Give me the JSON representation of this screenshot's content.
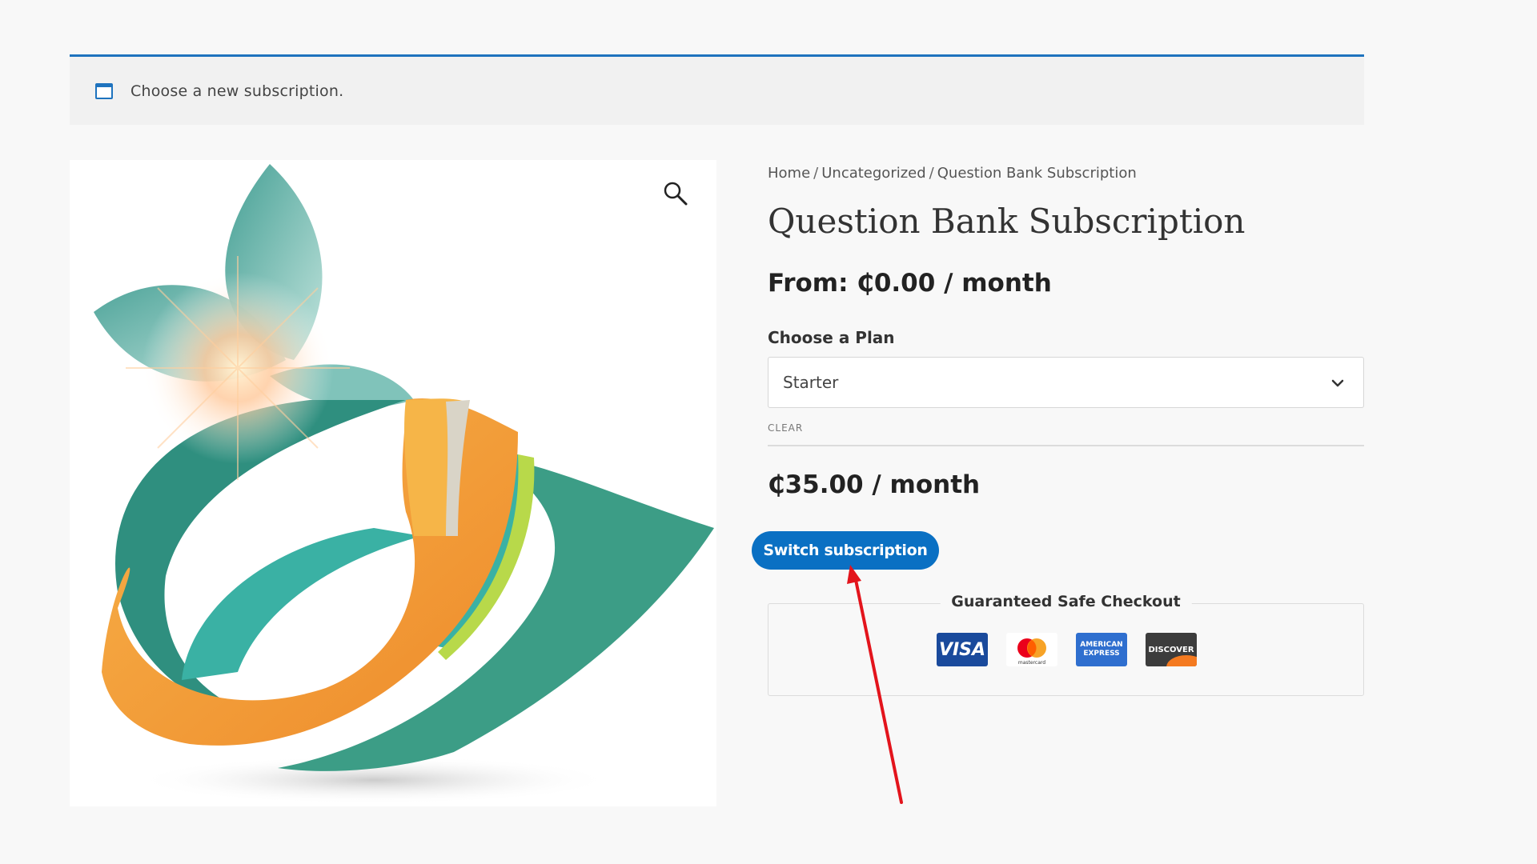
{
  "notice": {
    "icon": "calendar-window-icon",
    "text": "Choose a new subscription."
  },
  "product_image": {
    "description_icon": "abstract-logo-image",
    "zoom_icon": "magnifier-icon"
  },
  "breadcrumb": {
    "items": [
      "Home",
      "Uncategorized"
    ],
    "separator": "/",
    "current": "Question Bank Subscription"
  },
  "product": {
    "title": "Question Bank Subscription",
    "price_from": "From: ₵0.00 / month",
    "plan_label": "Choose a Plan",
    "plan_selected": "Starter",
    "clear_label": "CLEAR",
    "variation_price": "₵35.00 / month",
    "switch_button_label": "Switch subscription"
  },
  "safe_checkout": {
    "title": "Guaranteed Safe Checkout",
    "cards": [
      {
        "name": "visa",
        "label": "VISA"
      },
      {
        "name": "mastercard",
        "label": "mastercard"
      },
      {
        "name": "american-express",
        "label_line1": "AMERICAN",
        "label_line2": "EXPRESS"
      },
      {
        "name": "discover",
        "label": "DISCOVER"
      }
    ]
  },
  "colors": {
    "accent": "#1e73be",
    "button": "#0a70c3",
    "annotation_arrow": "#e3141c",
    "logo_orange": "#f39a35",
    "logo_teal": "#3ca99a"
  }
}
